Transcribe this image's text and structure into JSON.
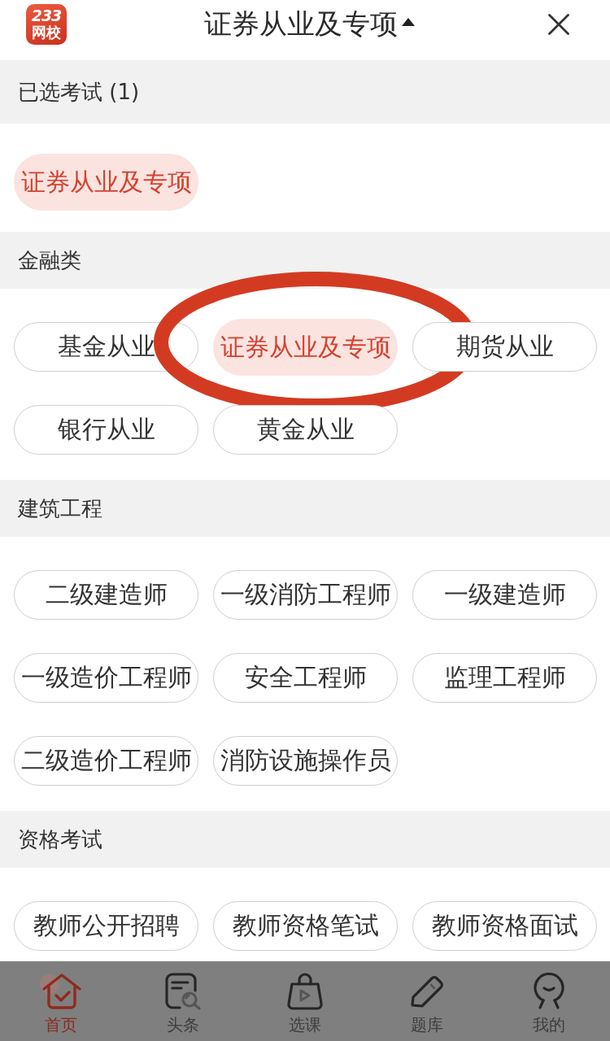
{
  "header": {
    "logo": {
      "number": "233",
      "name": "网校"
    },
    "title": "证券从业及专项",
    "expanded": true
  },
  "sections": [
    {
      "title": "已选考试 (1)",
      "chips": [
        {
          "label": "证券从业及专项",
          "selected": true,
          "circled": false
        }
      ]
    },
    {
      "title": "金融类",
      "chips": [
        {
          "label": "基金从业",
          "selected": false,
          "circled": false
        },
        {
          "label": "证券从业及专项",
          "selected": true,
          "circled": true
        },
        {
          "label": "期货从业",
          "selected": false,
          "circled": false
        },
        {
          "label": "银行从业",
          "selected": false,
          "circled": false
        },
        {
          "label": "黄金从业",
          "selected": false,
          "circled": false
        }
      ]
    },
    {
      "title": "建筑工程",
      "chips": [
        {
          "label": "二级建造师",
          "selected": false,
          "circled": false
        },
        {
          "label": "一级消防工程师",
          "selected": false,
          "circled": false
        },
        {
          "label": "一级建造师",
          "selected": false,
          "circled": false
        },
        {
          "label": "一级造价工程师",
          "selected": false,
          "circled": false
        },
        {
          "label": "安全工程师",
          "selected": false,
          "circled": false
        },
        {
          "label": "监理工程师",
          "selected": false,
          "circled": false
        },
        {
          "label": "二级造价工程师",
          "selected": false,
          "circled": false
        },
        {
          "label": "消防设施操作员",
          "selected": false,
          "circled": false
        }
      ]
    },
    {
      "title": "资格考试",
      "chips": [
        {
          "label": "教师公开招聘",
          "selected": false,
          "circled": false
        },
        {
          "label": "教师资格笔试",
          "selected": false,
          "circled": false
        },
        {
          "label": "教师资格面试",
          "selected": false,
          "circled": false
        }
      ]
    }
  ],
  "tab_bar": {
    "tabs": [
      {
        "label": "首页",
        "kind": "house",
        "selected": true
      },
      {
        "label": "头条",
        "kind": "document",
        "selected": false
      },
      {
        "label": "选课",
        "kind": "bag",
        "selected": false
      },
      {
        "label": "题库",
        "kind": "pencil",
        "selected": false
      },
      {
        "label": "我的",
        "kind": "face",
        "selected": false
      }
    ]
  }
}
